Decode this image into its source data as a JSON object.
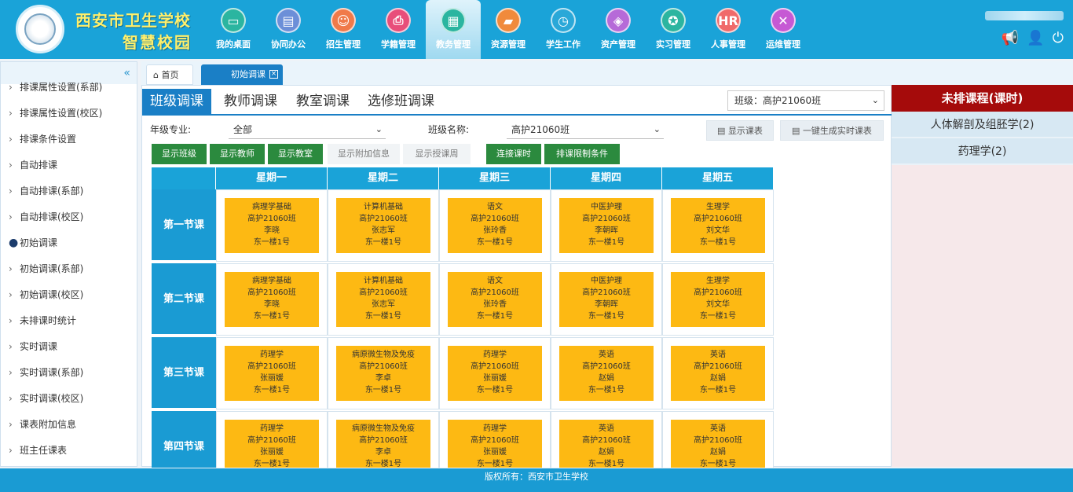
{
  "header": {
    "brand_line1": "西安市卫生学校",
    "brand_line2": "智慧校园",
    "nav": [
      {
        "label": "我的桌面",
        "color": "#2bb5a0",
        "icon": "desktop-icon"
      },
      {
        "label": "协同办公",
        "color": "#6c8fd8",
        "icon": "document-icon"
      },
      {
        "label": "招生管理",
        "color": "#f07a4a",
        "icon": "user-icon"
      },
      {
        "label": "学籍管理",
        "color": "#e84e7a",
        "icon": "printer-icon"
      },
      {
        "label": "教务管理",
        "color": "#2bb5a0",
        "icon": "chart-icon"
      },
      {
        "label": "资源管理",
        "color": "#f08a3c",
        "icon": "folder-icon"
      },
      {
        "label": "学生工作",
        "color": "#2aa8d8",
        "icon": "clock-icon"
      },
      {
        "label": "资产管理",
        "color": "#b66ad8",
        "icon": "cube-icon"
      },
      {
        "label": "实习管理",
        "color": "#2bb5a0",
        "icon": "medal-icon"
      },
      {
        "label": "人事管理",
        "color": "#f06a6a",
        "icon": "hr-icon"
      },
      {
        "label": "运维管理",
        "color": "#c659d4",
        "icon": "tools-icon"
      }
    ],
    "active_nav_index": 4
  },
  "sidebar": {
    "collapse_icon": "«",
    "items": [
      {
        "label": "排课属性设置(系部)"
      },
      {
        "label": "排课属性设置(校区)"
      },
      {
        "label": "排课条件设置"
      },
      {
        "label": "自动排课"
      },
      {
        "label": "自动排课(系部)"
      },
      {
        "label": "自动排课(校区)"
      },
      {
        "label": "初始调课",
        "active": true
      },
      {
        "label": "初始调课(系部)"
      },
      {
        "label": "初始调课(校区)"
      },
      {
        "label": "未排课时统计"
      },
      {
        "label": "实时调课"
      },
      {
        "label": "实时调课(系部)"
      },
      {
        "label": "实时调课(校区)"
      },
      {
        "label": "课表附加信息"
      },
      {
        "label": "班主任课表"
      }
    ]
  },
  "tabs": {
    "home": "首页",
    "current": "初始调课"
  },
  "subtabs": [
    "班级调课",
    "教师调课",
    "教室调课",
    "选修班调课"
  ],
  "class_select": "班级：高护21060班",
  "filters": {
    "grade_label": "年级专业:",
    "grade_value": "全部",
    "class_label": "班级名称:",
    "class_value": "高护21060班"
  },
  "buttons": {
    "show_schedule": "显示课表",
    "gen_schedule": "一键生成实时课表",
    "show_class": "显示班级",
    "show_teacher": "显示教师",
    "show_room": "显示教室",
    "show_extra": "显示附加信息",
    "show_week": "显示授课周",
    "link_hours": "连接课时",
    "limit": "排课限制条件"
  },
  "schedule": {
    "days": [
      "星期一",
      "星期二",
      "星期三",
      "星期四",
      "星期五"
    ],
    "periods": [
      "第一节课",
      "第二节课",
      "第三节课",
      "第四节课"
    ],
    "rows": [
      [
        {
          "course": "病理学基础",
          "cls": "高护21060班",
          "teacher": "李晓",
          "room": "东一楼1号"
        },
        {
          "course": "计算机基础",
          "cls": "高护21060班",
          "teacher": "张志军",
          "room": "东一楼1号"
        },
        {
          "course": "语文",
          "cls": "高护21060班",
          "teacher": "张玲香",
          "room": "东一楼1号"
        },
        {
          "course": "中医护理",
          "cls": "高护21060班",
          "teacher": "李朝晖",
          "room": "东一楼1号"
        },
        {
          "course": "生理学",
          "cls": "高护21060班",
          "teacher": "刘文华",
          "room": "东一楼1号"
        }
      ],
      [
        {
          "course": "病理学基础",
          "cls": "高护21060班",
          "teacher": "李晓",
          "room": "东一楼1号"
        },
        {
          "course": "计算机基础",
          "cls": "高护21060班",
          "teacher": "张志军",
          "room": "东一楼1号"
        },
        {
          "course": "语文",
          "cls": "高护21060班",
          "teacher": "张玲香",
          "room": "东一楼1号"
        },
        {
          "course": "中医护理",
          "cls": "高护21060班",
          "teacher": "李朝晖",
          "room": "东一楼1号"
        },
        {
          "course": "生理学",
          "cls": "高护21060班",
          "teacher": "刘文华",
          "room": "东一楼1号"
        }
      ],
      [
        {
          "course": "药理学",
          "cls": "高护21060班",
          "teacher": "张丽媛",
          "room": "东一楼1号"
        },
        {
          "course": "病原微生物及免疫",
          "cls": "高护21060班",
          "teacher": "李卓",
          "room": "东一楼1号"
        },
        {
          "course": "药理学",
          "cls": "高护21060班",
          "teacher": "张丽媛",
          "room": "东一楼1号"
        },
        {
          "course": "英语",
          "cls": "高护21060班",
          "teacher": "赵娟",
          "room": "东一楼1号"
        },
        {
          "course": "英语",
          "cls": "高护21060班",
          "teacher": "赵娟",
          "room": "东一楼1号"
        }
      ],
      [
        {
          "course": "药理学",
          "cls": "高护21060班",
          "teacher": "张丽媛",
          "room": "东一楼1号"
        },
        {
          "course": "病原微生物及免疫",
          "cls": "高护21060班",
          "teacher": "李卓",
          "room": "东一楼1号"
        },
        {
          "course": "药理学",
          "cls": "高护21060班",
          "teacher": "张丽媛",
          "room": "东一楼1号"
        },
        {
          "course": "英语",
          "cls": "高护21060班",
          "teacher": "赵娟",
          "room": "东一楼1号"
        },
        {
          "course": "英语",
          "cls": "高护21060班",
          "teacher": "赵娟",
          "room": "东一楼1号"
        }
      ]
    ]
  },
  "unscheduled": {
    "title": "未排课程(课时)",
    "items": [
      "人体解剖及组胚学(2)",
      "药理学(2)"
    ]
  },
  "footer": "版权所有：西安市卫生学校"
}
